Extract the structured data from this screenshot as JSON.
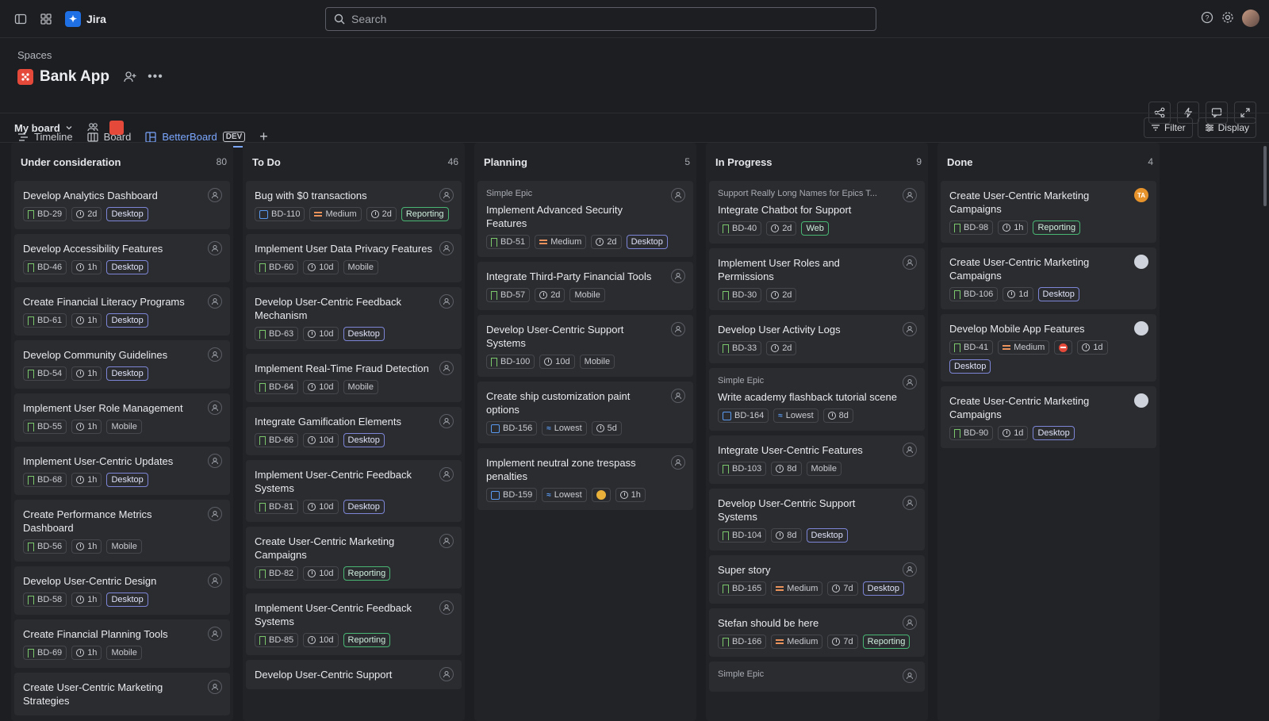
{
  "app": {
    "name": "Jira"
  },
  "search": {
    "placeholder": "Search"
  },
  "header": {
    "breadcrumb": "Spaces",
    "project_title": "Bank App"
  },
  "tabs": [
    {
      "label": "Timeline"
    },
    {
      "label": "Board"
    },
    {
      "label": "BetterBoard",
      "badge": "DEV"
    }
  ],
  "subbar": {
    "board_select": "My board",
    "filter_label": "Filter",
    "display_label": "Display"
  },
  "columns": [
    {
      "title": "Under consideration",
      "count": "80",
      "cards": [
        {
          "title": "Develop Analytics Dashboard",
          "key": "BD-29",
          "time": "2d",
          "tag": "Desktop"
        },
        {
          "title": "Develop Accessibility Features",
          "key": "BD-46",
          "time": "1h",
          "tag": "Desktop"
        },
        {
          "title": "Create Financial Literacy Programs",
          "key": "BD-61",
          "time": "1h",
          "tag": "Desktop"
        },
        {
          "title": "Develop Community Guidelines",
          "key": "BD-54",
          "time": "1h",
          "tag": "Desktop"
        },
        {
          "title": "Implement User Role Management",
          "key": "BD-55",
          "time": "1h",
          "tag": "Mobile"
        },
        {
          "title": "Implement User-Centric Updates",
          "key": "BD-68",
          "time": "1h",
          "tag": "Desktop"
        },
        {
          "title": "Create Performance Metrics Dashboard",
          "key": "BD-56",
          "time": "1h",
          "tag": "Mobile"
        },
        {
          "title": "Develop User-Centric Design",
          "key": "BD-58",
          "time": "1h",
          "tag": "Desktop"
        },
        {
          "title": "Create Financial Planning Tools",
          "key": "BD-69",
          "time": "1h",
          "tag": "Mobile"
        },
        {
          "title": "Create User-Centric Marketing Strategies"
        }
      ]
    },
    {
      "title": "To Do",
      "count": "46",
      "cards": [
        {
          "title": "Bug with $0 transactions",
          "key": "BD-110",
          "priority": "Medium",
          "time": "2d",
          "tag": "Reporting"
        },
        {
          "title": "Implement User Data Privacy Features",
          "key": "BD-60",
          "time": "10d",
          "tag": "Mobile"
        },
        {
          "title": "Develop User-Centric Feedback Mechanism",
          "key": "BD-63",
          "time": "10d",
          "tag": "Desktop"
        },
        {
          "title": "Implement Real-Time Fraud Detection",
          "key": "BD-64",
          "time": "10d",
          "tag": "Mobile"
        },
        {
          "title": "Integrate Gamification Elements",
          "key": "BD-66",
          "time": "10d",
          "tag": "Desktop"
        },
        {
          "title": "Implement User-Centric Feedback Systems",
          "key": "BD-81",
          "time": "10d",
          "tag": "Desktop"
        },
        {
          "title": "Create User-Centric Marketing Campaigns",
          "key": "BD-82",
          "time": "10d",
          "tag": "Reporting"
        },
        {
          "title": "Implement User-Centric Feedback Systems",
          "key": "BD-85",
          "time": "10d",
          "tag": "Reporting"
        },
        {
          "title": "Develop User-Centric Support"
        }
      ]
    },
    {
      "title": "Planning",
      "count": "5",
      "cards": [
        {
          "epic": "Simple Epic",
          "title": "Implement Advanced Security Features",
          "key": "BD-51",
          "priority": "Medium",
          "time": "2d",
          "tag": "Desktop"
        },
        {
          "title": "Integrate Third-Party Financial Tools",
          "key": "BD-57",
          "time": "2d",
          "tag": "Mobile"
        },
        {
          "title": "Develop User-Centric Support Systems",
          "key": "BD-100",
          "time": "10d",
          "tag": "Mobile"
        },
        {
          "title": "Create ship customization paint options",
          "key": "BD-156",
          "priority": "Lowest",
          "time": "5d"
        },
        {
          "title": "Implement neutral zone trespass penalties",
          "key": "BD-159",
          "priority": "Lowest",
          "time": "1h"
        }
      ]
    },
    {
      "title": "In Progress",
      "count": "9",
      "cards": [
        {
          "epic": "Support Really Long Names for Epics T...",
          "title": "Integrate Chatbot for Support",
          "key": "BD-40",
          "time": "2d",
          "tag": "Web"
        },
        {
          "title": "Implement User Roles and Permissions",
          "key": "BD-30",
          "time": "2d"
        },
        {
          "title": "Develop User Activity Logs",
          "key": "BD-33",
          "time": "2d"
        },
        {
          "epic": "Simple Epic",
          "title": "Write academy flashback tutorial scene",
          "key": "BD-164",
          "priority": "Lowest",
          "time": "8d"
        },
        {
          "title": "Integrate User-Centric Features",
          "key": "BD-103",
          "time": "8d",
          "tag": "Mobile"
        },
        {
          "title": "Develop User-Centric Support Systems",
          "key": "BD-104",
          "time": "8d",
          "tag": "Desktop"
        },
        {
          "title": "Super story",
          "key": "BD-165",
          "priority": "Medium",
          "time": "7d",
          "tag": "Desktop"
        },
        {
          "title": "Stefan should be here",
          "key": "BD-166",
          "priority": "Medium",
          "time": "7d",
          "tag": "Reporting"
        },
        {
          "epic": "Simple Epic"
        }
      ]
    },
    {
      "title": "Done",
      "count": "4",
      "cards": [
        {
          "title": "Create User-Centric Marketing Campaigns",
          "key": "BD-98",
          "time": "1h",
          "tag": "Reporting",
          "assignee_initials": "TA"
        },
        {
          "title": "Create User-Centric Marketing Campaigns",
          "key": "BD-106",
          "time": "1d",
          "tag": "Desktop"
        },
        {
          "title": "Develop Mobile App Features",
          "key": "BD-41",
          "priority": "Medium",
          "time": "1d",
          "tag": "Desktop"
        },
        {
          "title": "Create User-Centric Marketing Campaigns",
          "key": "BD-90",
          "time": "1d",
          "tag": "Desktop"
        }
      ]
    }
  ],
  "colors": {
    "background": "#1d1e21",
    "card": "#2b2c30",
    "accent": "#7ba7ff",
    "project": "#e5493a"
  }
}
